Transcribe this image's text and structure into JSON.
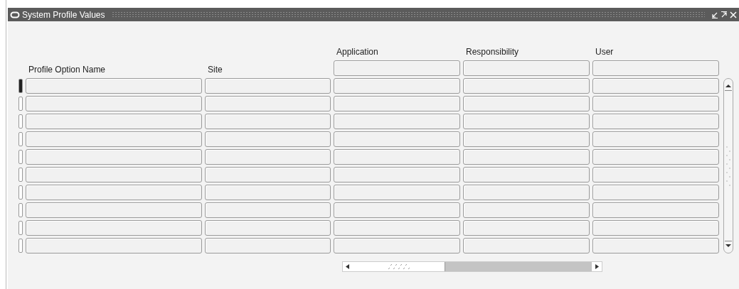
{
  "window": {
    "title": "System Profile Values"
  },
  "columns": [
    {
      "label": "Profile Option Name",
      "kind": "plain"
    },
    {
      "label": "Site",
      "kind": "plain"
    },
    {
      "label": "Application",
      "kind": "context"
    },
    {
      "label": "Responsibility",
      "kind": "context"
    },
    {
      "label": "User",
      "kind": "context"
    }
  ],
  "rows": [
    {
      "selected": true
    },
    {
      "selected": false
    },
    {
      "selected": false
    },
    {
      "selected": false
    },
    {
      "selected": false
    },
    {
      "selected": false
    },
    {
      "selected": false
    },
    {
      "selected": false
    },
    {
      "selected": false
    },
    {
      "selected": false
    }
  ]
}
